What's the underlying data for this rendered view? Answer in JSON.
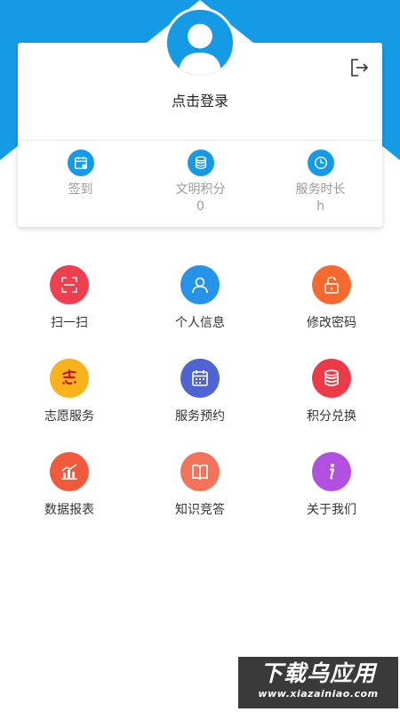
{
  "header": {
    "login_text": "点击登录",
    "accent_color": "#159be6"
  },
  "stats": [
    {
      "icon": "calendar-icon",
      "label": "签到",
      "value": ""
    },
    {
      "icon": "coins-icon",
      "label": "文明积分",
      "value": "0"
    },
    {
      "icon": "clock-icon",
      "label": "服务时长",
      "value": "h"
    }
  ],
  "menu": [
    {
      "icon": "scan-icon",
      "label": "扫一扫",
      "color": "#ef3f4f"
    },
    {
      "icon": "user-icon",
      "label": "个人信息",
      "color": "#2593e8"
    },
    {
      "icon": "lock-icon",
      "label": "修改密码",
      "color": "#f5692e"
    },
    {
      "icon": "volunteer-icon",
      "label": "志愿服务",
      "color": "#f7b21c"
    },
    {
      "icon": "calendar-icon",
      "label": "服务预约",
      "color": "#4f63d2"
    },
    {
      "icon": "coins-icon",
      "label": "积分兑换",
      "color": "#ec3a46"
    },
    {
      "icon": "chart-icon",
      "label": "数据报表",
      "color": "#f05a3a"
    },
    {
      "icon": "book-icon",
      "label": "知识竞答",
      "color": "#f2735a"
    },
    {
      "icon": "info-icon",
      "label": "关于我们",
      "color": "#b14fe0"
    }
  ],
  "watermark": {
    "title": "下载乌应用",
    "url": "www.xiazainiao.com"
  }
}
